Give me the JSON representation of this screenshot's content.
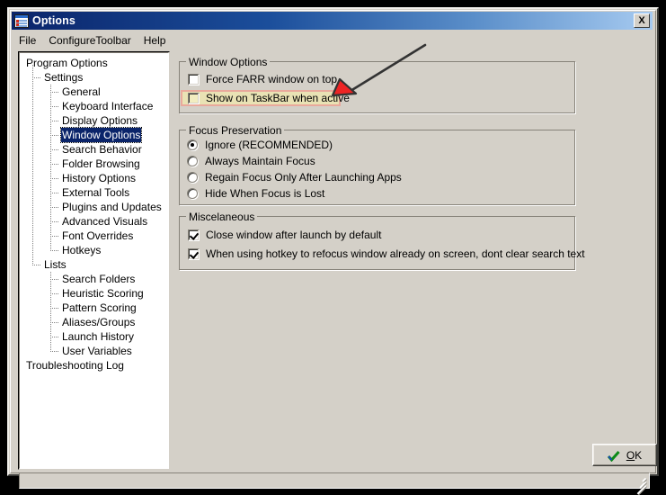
{
  "window": {
    "title": "Options",
    "icon": "options-list-icon",
    "close_label": "X"
  },
  "menubar": {
    "items": [
      {
        "label": "File"
      },
      {
        "label": "ConfigureToolbar"
      },
      {
        "label": "Help"
      }
    ]
  },
  "tree": {
    "nodes": [
      {
        "label": "Program Options",
        "level": 0,
        "selected": false
      },
      {
        "label": "Settings",
        "level": 1,
        "selected": false
      },
      {
        "label": "General",
        "level": 2,
        "selected": false
      },
      {
        "label": "Keyboard Interface",
        "level": 2,
        "selected": false
      },
      {
        "label": "Display Options",
        "level": 2,
        "selected": false
      },
      {
        "label": "Window Options",
        "level": 2,
        "selected": true
      },
      {
        "label": "Search Behavior",
        "level": 2,
        "selected": false
      },
      {
        "label": "Folder Browsing",
        "level": 2,
        "selected": false
      },
      {
        "label": "History Options",
        "level": 2,
        "selected": false
      },
      {
        "label": "External Tools",
        "level": 2,
        "selected": false
      },
      {
        "label": "Plugins and Updates",
        "level": 2,
        "selected": false
      },
      {
        "label": "Advanced Visuals",
        "level": 2,
        "selected": false
      },
      {
        "label": "Font Overrides",
        "level": 2,
        "selected": false
      },
      {
        "label": "Hotkeys",
        "level": 2,
        "selected": false
      },
      {
        "label": "Lists",
        "level": 1,
        "selected": false
      },
      {
        "label": "Search Folders",
        "level": 2,
        "selected": false
      },
      {
        "label": "Heuristic Scoring",
        "level": 2,
        "selected": false
      },
      {
        "label": "Pattern Scoring",
        "level": 2,
        "selected": false
      },
      {
        "label": "Aliases/Groups",
        "level": 2,
        "selected": false
      },
      {
        "label": "Launch History",
        "level": 2,
        "selected": false
      },
      {
        "label": "User Variables",
        "level": 2,
        "selected": false
      },
      {
        "label": "Troubleshooting Log",
        "level": 0,
        "selected": false
      }
    ]
  },
  "groups": {
    "window_options": {
      "title": "Window Options",
      "options": [
        {
          "label": "Force FARR window on top",
          "checked": false,
          "highlighted": false
        },
        {
          "label": "Show on TaskBar when active",
          "checked": false,
          "highlighted": true
        }
      ]
    },
    "focus_preservation": {
      "title": "Focus Preservation",
      "options": [
        {
          "label": "Ignore (RECOMMENDED)",
          "selected": true
        },
        {
          "label": "Always Maintain Focus",
          "selected": false
        },
        {
          "label": "Regain Focus Only After Launching Apps",
          "selected": false
        },
        {
          "label": "Hide When Focus is Lost",
          "selected": false
        }
      ]
    },
    "miscelaneous": {
      "title": "Miscelaneous",
      "options": [
        {
          "label": "Close window after launch by default",
          "checked": true
        },
        {
          "label": "When using hotkey to refocus window already on screen, dont clear search text",
          "checked": true
        }
      ]
    }
  },
  "buttons": {
    "ok": {
      "prefix": "O",
      "suffix": "K",
      "icon": "green-check-icon"
    }
  },
  "annotation": {
    "arrow": "red-arrowhead-pointer",
    "color_arrow_head": "#ee2424",
    "color_arrow_line": "#333333",
    "color_highlight_fill": "#e9e2b4",
    "color_highlight_border": "#e9a99c"
  },
  "statusbar": {
    "text": ""
  },
  "colors": {
    "face": "#d4d0c8",
    "title_start": "#0a246a",
    "title_end": "#a6caf0",
    "selection": "#0a246a"
  }
}
